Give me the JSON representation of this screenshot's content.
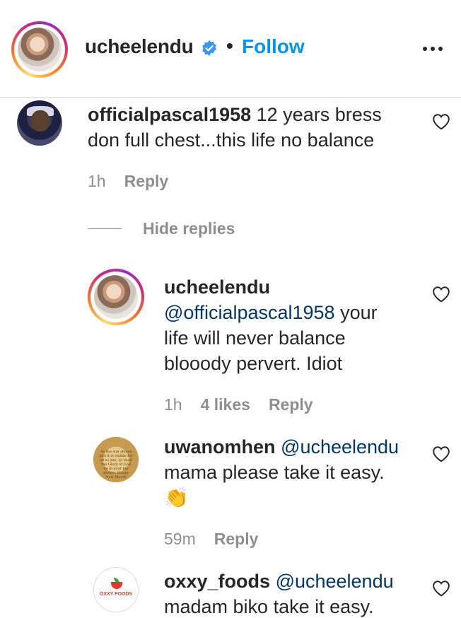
{
  "header": {
    "username": "ucheelendu",
    "separator": "•",
    "follow_label": "Follow",
    "verified_color": "#3897f0"
  },
  "comments": [
    {
      "username": "officialpascal1958",
      "text_line1": " 12 years bress",
      "text_line2": "don full chest...this life no balance",
      "time": "1h",
      "reply_label": "Reply"
    }
  ],
  "hide_replies_label": "Hide replies",
  "replies": [
    {
      "username": "ucheelendu",
      "mention": "@officialpascal1958",
      "text_line1": " your",
      "text_line2": "life will never balance",
      "text_line3": "blooody pervert. Idiot",
      "time": "1h",
      "likes": "4 likes",
      "reply_label": "Reply"
    },
    {
      "username": "uwanomhen",
      "mention": "@ucheelendu",
      "text_line1": "mama please take it easy.",
      "emoji": "👏",
      "avatar_text": "As the sun shines and it is visible for all to see, so shall the Glory of God be in your life always. Happy New Month",
      "time": "59m",
      "reply_label": "Reply"
    },
    {
      "username": "oxxy_foods",
      "mention": "@ucheelendu",
      "text_line1": "madam biko take it easy.",
      "avatar_text": "OXXY FOODS"
    }
  ],
  "colors": {
    "link": "#0095f6",
    "mention": "#00376b",
    "muted": "#8e8e8e"
  }
}
